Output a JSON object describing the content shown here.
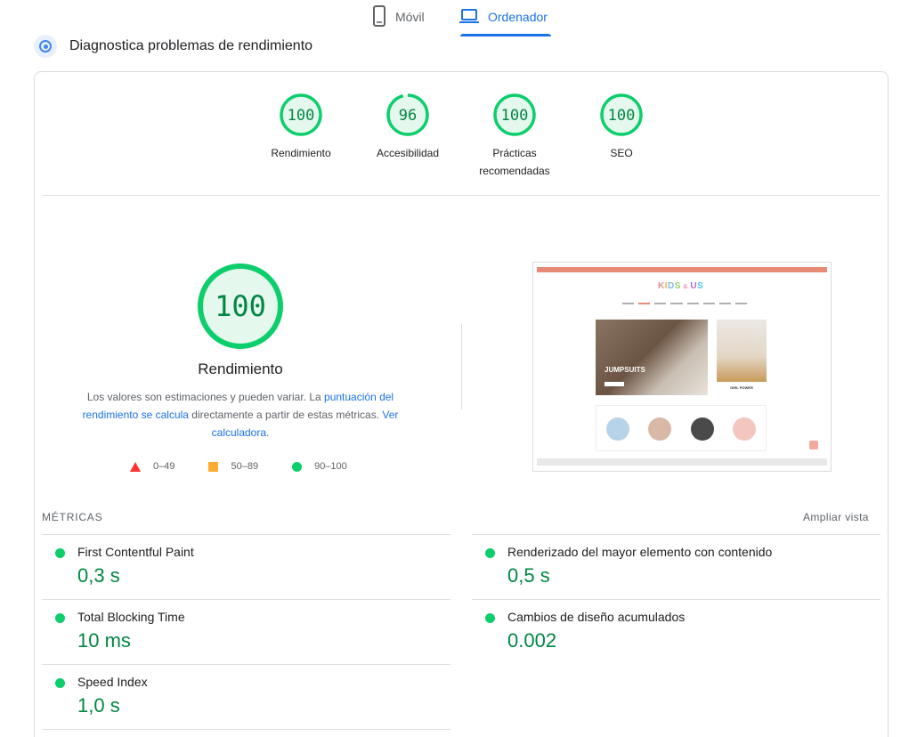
{
  "tabs": {
    "mobile_label": "Móvil",
    "desktop_label": "Ordenador",
    "active": "Ordenador"
  },
  "section": {
    "title": "Diagnostica problemas de rendimiento"
  },
  "scores": [
    {
      "value": 100,
      "label_line1": "Rendimiento",
      "label_line2": ""
    },
    {
      "value": 96,
      "label_line1": "Accesibilidad",
      "label_line2": ""
    },
    {
      "value": 100,
      "label_line1": "Prácticas",
      "label_line2": "recomendadas"
    },
    {
      "value": 100,
      "label_line1": "SEO",
      "label_line2": ""
    }
  ],
  "performance": {
    "score": 100,
    "label": "Rendimiento",
    "desc_part1": "Los valores son estimaciones y pueden variar. La ",
    "desc_link1": "puntuación del rendimiento se calcula",
    "desc_part2": " directamente a partir de estas métricas. ",
    "desc_link2": "Ver calculadora",
    "desc_part3": "."
  },
  "legend": {
    "fail": "0–49",
    "average": "50–89",
    "pass": "90–100"
  },
  "thumbnail": {
    "logo": "KIDS & US",
    "hero_text": "JUMPSUITS",
    "side_text": "GIRL POWER"
  },
  "metrics": {
    "heading": "MÉTRICAS",
    "expand_label": "Ampliar vista",
    "fcp": {
      "title": "First Contentful Paint",
      "value": "0,3 s"
    },
    "lcp": {
      "title": "Renderizado del mayor elemento con contenido",
      "value": "0,5 s"
    },
    "tbt": {
      "title": "Total Blocking Time",
      "value": "10 ms"
    },
    "cls": {
      "title": "Cambios de diseño acumulados",
      "value": "0.002"
    },
    "si": {
      "title": "Speed Index",
      "value": "1,0 s"
    }
  },
  "colors": {
    "pass": "#0cce6b",
    "pass_text": "#018642",
    "average": "#ffaa33",
    "fail": "#ff3333",
    "accent": "#1a73e8",
    "gauge_fill": "#e5f8ed"
  }
}
